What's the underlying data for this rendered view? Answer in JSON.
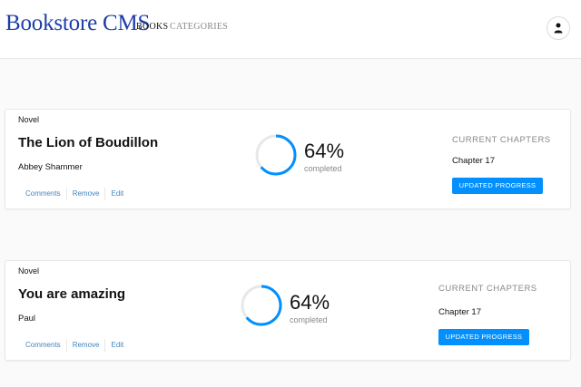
{
  "header": {
    "logo": "Bookstore CMS",
    "nav": [
      {
        "label": "BOOKS"
      },
      {
        "label": "CATEGORIES"
      }
    ],
    "user_icon": "user-icon"
  },
  "books": [
    {
      "genre": "Novel",
      "title": "The Lion of Boudillon",
      "author": "Abbey Shammer",
      "actions": [
        "Comments",
        "Remove",
        "Edit"
      ],
      "progress_percent": "64%",
      "progress_value": 64,
      "completed_label": "completed",
      "current_chapter_label": "CURRENT CHAPTERS",
      "current_chapter": "Chapter 17",
      "update_button": "UPDATED PROGRESS"
    },
    {
      "genre": "Novel",
      "title": "You are amazing",
      "author": "Paul",
      "actions": [
        "Comments",
        "Remove",
        "Edit"
      ],
      "progress_percent": "64%",
      "progress_value": 64,
      "completed_label": "completed",
      "current_chapter_label": "CURRENT CHAPTERS",
      "current_chapter": "Chapter 17",
      "update_button": "UPDATED PROGRESS"
    }
  ],
  "colors": {
    "accent": "#0290ff",
    "logo": "#1d3ea8",
    "link": "#4386bf"
  }
}
